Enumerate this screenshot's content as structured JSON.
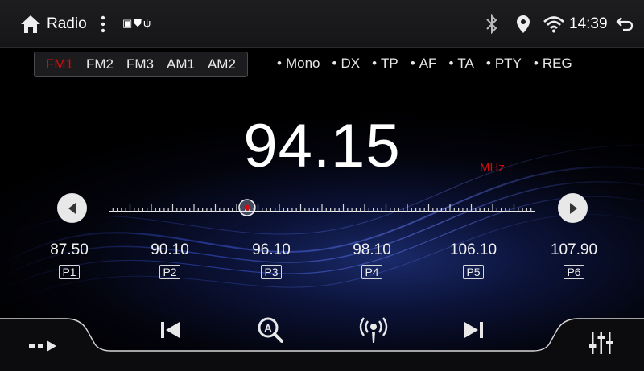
{
  "status_bar": {
    "app_title": "Radio",
    "notification_icons": "▣⛊ψ",
    "time": "14:39",
    "icons": [
      "home-icon",
      "more-vert-icon",
      "bluetooth-icon",
      "location-icon",
      "wifi-icon",
      "back-icon"
    ]
  },
  "band_tabs": [
    {
      "label": "FM1",
      "active": true
    },
    {
      "label": "FM2",
      "active": false
    },
    {
      "label": "FM3",
      "active": false
    },
    {
      "label": "AM1",
      "active": false
    },
    {
      "label": "AM2",
      "active": false
    }
  ],
  "flags": [
    "Mono",
    "DX",
    "TP",
    "AF",
    "TA",
    "PTY",
    "REG"
  ],
  "tuner": {
    "frequency": "94.15",
    "unit": "MHz",
    "band_min": 87.5,
    "band_max": 108.0
  },
  "presets": [
    {
      "freq": "87.50",
      "tag": "P1"
    },
    {
      "freq": "90.10",
      "tag": "P2"
    },
    {
      "freq": "96.10",
      "tag": "P3"
    },
    {
      "freq": "98.10",
      "tag": "P4"
    },
    {
      "freq": "106.10",
      "tag": "P5"
    },
    {
      "freq": "107.90",
      "tag": "P6"
    }
  ],
  "colors": {
    "accent_red": "#d00d0d",
    "text": "#ffffff"
  }
}
